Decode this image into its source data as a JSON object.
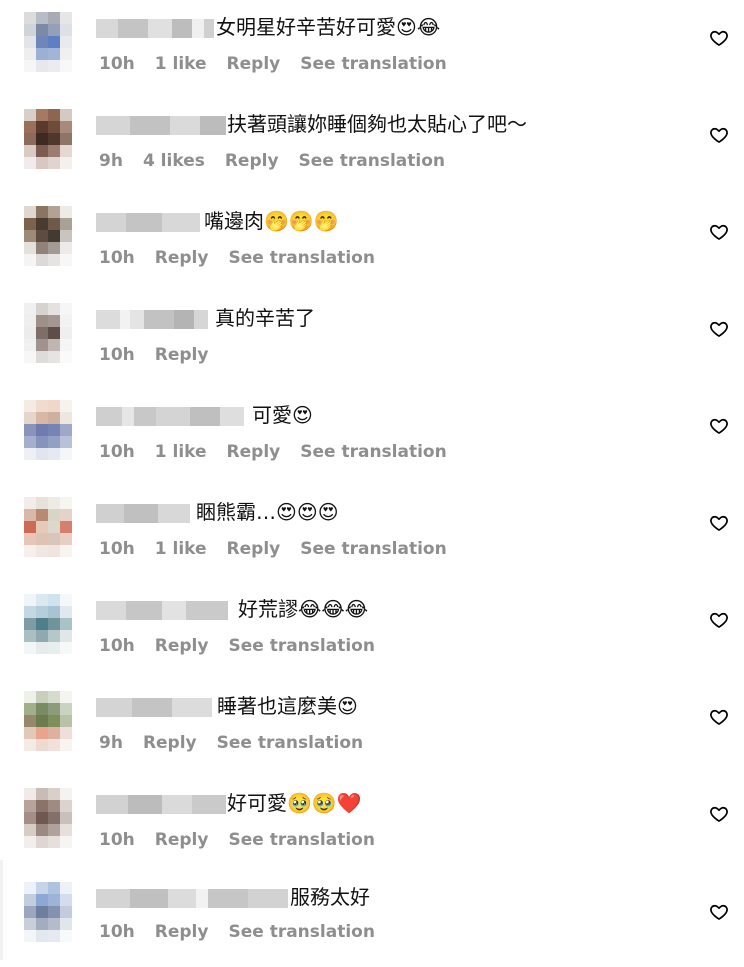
{
  "comments": [
    {
      "text": "女明星好辛苦好可愛😍😂",
      "time": "10h",
      "likes": "1 like",
      "reply": "Reply",
      "translate": "See translation",
      "avatar": [
        "#dcdcdc",
        "#b8bcc6",
        "#a8aab4",
        "#e6e6e6",
        "#cfd3da",
        "#7c8aa4",
        "#94a0b8",
        "#dde0e6",
        "#e2e4ea",
        "#6f86b8",
        "#5f7fc3",
        "#e8eaef",
        "#eeeeee",
        "#9cb0d6",
        "#a2b4d8",
        "#f0f0f0",
        "#f6f6f6",
        "#e8e8ec",
        "#ececf0",
        "#f8f8f8"
      ],
      "user": [
        [
          "#d8d8d8",
          22
        ],
        [
          "#c4c4c4",
          30
        ],
        [
          "#e0e0e0",
          24
        ],
        [
          "#bdbdbd",
          20
        ],
        [
          "#f0f0f0",
          12
        ],
        [
          "#d0d0d0",
          10
        ]
      ]
    },
    {
      "text": "扶著頭讓妳睡個夠也太貼心了吧～",
      "time": "9h",
      "likes": "4 likes",
      "reply": "Reply",
      "translate": "See translation",
      "avatar": [
        "#d9cfc9",
        "#a47a62",
        "#8d6551",
        "#d6c9c2",
        "#9b6f59",
        "#5a3a2c",
        "#6e4b3b",
        "#a88a7c",
        "#8c6a5c",
        "#3f2a22",
        "#4f372c",
        "#8f7468",
        "#d8cbc4",
        "#7c5c50",
        "#9a7c70",
        "#e3d8d3",
        "#f1eceb",
        "#d8c8c3",
        "#e1d4d0",
        "#f4f0ee"
      ],
      "user": [
        [
          "#d6d6d6",
          34
        ],
        [
          "#c2c2c2",
          40
        ],
        [
          "#dadada",
          30
        ],
        [
          "#bcbcbc",
          26
        ]
      ]
    },
    {
      "text": "嘴邊肉🤭🤭🤭",
      "time": "10h",
      "likes": "",
      "reply": "Reply",
      "translate": "See translation",
      "avatar": [
        "#e0d8d0",
        "#8a7462",
        "#b1a293",
        "#eeeae6",
        "#7a624e",
        "#4a3b30",
        "#6d5a4b",
        "#a9a096",
        "#9d8a78",
        "#5e4c40",
        "#433a34",
        "#c9c4bf",
        "#e4e0dc",
        "#8f8279",
        "#a39a93",
        "#ecebea",
        "#f5f4f3",
        "#dcdad8",
        "#e6e4e2",
        "#f7f7f7"
      ],
      "user": [
        [
          "#d4d4d4",
          30
        ],
        [
          "#c4c4c4",
          36
        ],
        [
          "#d8d8d8",
          38
        ]
      ]
    },
    {
      "text": "真的辛苦了",
      "time": "10h",
      "likes": "",
      "reply": "Reply",
      "translate": "",
      "avatar": [
        "#f0f0f0",
        "#d5d2d0",
        "#e4e2e1",
        "#f6f6f6",
        "#eeeeee",
        "#9d8f89",
        "#a49791",
        "#f2f2f2",
        "#ececec",
        "#7f6d68",
        "#5e4d49",
        "#efefef",
        "#f0f0f0",
        "#a2928d",
        "#bfb5b2",
        "#f5f5f5",
        "#f7f7f7",
        "#dedcdb",
        "#e6e4e3",
        "#fafafa"
      ],
      "user": [
        [
          "#dcdcdc",
          24
        ],
        [
          "#f2f2f2",
          10
        ],
        [
          "#e4e4e4",
          14
        ],
        [
          "#c2c2c2",
          30
        ],
        [
          "#b4b4b4",
          20
        ],
        [
          "#d6d6d6",
          14
        ]
      ]
    },
    {
      "text": "可愛😍",
      "time": "10h",
      "likes": "1 like",
      "reply": "Reply",
      "translate": "See translation",
      "avatar": [
        "#f4ebe3",
        "#f0dccd",
        "#efd8c7",
        "#f7f2ed",
        "#e6d5cb",
        "#d7b8a4",
        "#cdb09f",
        "#efe6e0",
        "#8a94b8",
        "#6f7cad",
        "#7684b3",
        "#a0a8c8",
        "#a5aecd",
        "#8893bd",
        "#93a0c6",
        "#b9c0da",
        "#eff0f5",
        "#e2e5ef",
        "#e6e9f1",
        "#f5f6f9"
      ],
      "user": [
        [
          "#cfcfcf",
          26
        ],
        [
          "#e6e6e6",
          12
        ],
        [
          "#c8c8c8",
          22
        ],
        [
          "#d4d4d4",
          34
        ],
        [
          "#bfbfbf",
          30
        ],
        [
          "#dedede",
          24
        ]
      ]
    },
    {
      "text": "睏熊霸…😍😍😍",
      "time": "10h",
      "likes": "1 like",
      "reply": "Reply",
      "translate": "See translation",
      "avatar": [
        "#f2ede9",
        "#e6e2da",
        "#ecebe4",
        "#f6f5f2",
        "#d8b8a8",
        "#b98a72",
        "#d8d4c6",
        "#e6d2c8",
        "#cc6a57",
        "#e7c9b8",
        "#ddd8cb",
        "#d4806c",
        "#e7c6b8",
        "#dcc3b4",
        "#d9c6ba",
        "#e8cec3",
        "#f6efeb",
        "#f1e7e2",
        "#f0e4de",
        "#f8f4f2"
      ],
      "user": [
        [
          "#d0d0d0",
          28
        ],
        [
          "#c0c0c0",
          34
        ],
        [
          "#d8d8d8",
          32
        ]
      ]
    },
    {
      "text": "好荒謬😂😂😂",
      "time": "10h",
      "likes": "",
      "reply": "Reply",
      "translate": "See translation",
      "avatar": [
        "#f1f5f8",
        "#dbe8f0",
        "#cfe2ee",
        "#f5f8fa",
        "#c4d8e4",
        "#b5cedc",
        "#a8c4d4",
        "#dfe9ef",
        "#7f9ca6",
        "#4f808a",
        "#6f949a",
        "#a9c2c8",
        "#a9bfc2",
        "#8fa9ae",
        "#b6c7c9",
        "#dfe7e8",
        "#f3f6f6",
        "#e6ecec",
        "#e8eeee",
        "#f7f9f9"
      ],
      "user": [
        [
          "#dadada",
          30
        ],
        [
          "#c6c6c6",
          36
        ],
        [
          "#e2e2e2",
          24
        ],
        [
          "#cacaca",
          42
        ]
      ]
    },
    {
      "text": "睡著也這麼美😍",
      "time": "9h",
      "likes": "",
      "reply": "Reply",
      "translate": "See translation",
      "avatar": [
        "#eef0ea",
        "#c8d0bd",
        "#d5dbcd",
        "#f4f5f1",
        "#a2ae8e",
        "#7a8b64",
        "#8e9b7a",
        "#cad3bf",
        "#97876d",
        "#6d7c4e",
        "#7f8f5a",
        "#b9c2a8",
        "#e2c8b8",
        "#e8a48c",
        "#dcb29f",
        "#eee0d8",
        "#f5ebe6",
        "#eedad0",
        "#f0e2da",
        "#f9f4f1"
      ],
      "user": [
        [
          "#d4d4d4",
          36
        ],
        [
          "#c4c4c4",
          40
        ],
        [
          "#dcdcdc",
          40
        ]
      ]
    },
    {
      "text": "好可愛🥹🥹❤️",
      "time": "10h",
      "likes": "",
      "reply": "Reply",
      "translate": "See translation",
      "avatar": [
        "#f0ebe8",
        "#c9bcb6",
        "#d9d0cc",
        "#f5f2f0",
        "#b7a39b",
        "#8c736a",
        "#a08b83",
        "#dcd2ce",
        "#a48f88",
        "#6f5852",
        "#84706a",
        "#cbbfbb",
        "#d8ccc7",
        "#9c8984",
        "#b1a19c",
        "#e6dfdc",
        "#f2eeec",
        "#dfd6d2",
        "#e6dfdc",
        "#f7f5f4"
      ],
      "user": [
        [
          "#d2d2d2",
          32
        ],
        [
          "#bcbcbc",
          34
        ],
        [
          "#dadada",
          30
        ],
        [
          "#cacaca",
          34
        ]
      ]
    },
    {
      "text": "服務太好",
      "time": "10h",
      "likes": "",
      "reply": "Reply",
      "translate": "See translation",
      "avatar": [
        "#eef2f8",
        "#c7d4e8",
        "#aec2e2",
        "#eef2f8",
        "#c2cde0",
        "#8ea8d4",
        "#9eb3d8",
        "#d4dded",
        "#9aa7bf",
        "#6e7f9e",
        "#8292b0",
        "#c3cbdc",
        "#c8cfdb",
        "#a3adc0",
        "#b4bccc",
        "#e1e5ec",
        "#f3f5f8",
        "#e3e7ee",
        "#e6e9ef",
        "#f8f9fb"
      ],
      "user": [
        [
          "#d4d4d4",
          34
        ],
        [
          "#c0c0c0",
          38
        ],
        [
          "#dcdcdc",
          28
        ],
        [
          "#f2f2f2",
          12
        ],
        [
          "#c6c6c6",
          40
        ],
        [
          "#d2d2d2",
          40
        ]
      ]
    }
  ]
}
